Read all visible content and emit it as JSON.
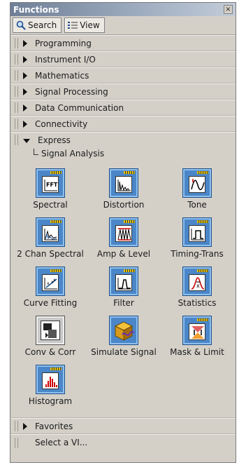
{
  "window": {
    "title": "Functions",
    "close_glyph": "×"
  },
  "toolbar": {
    "search_label": "Search",
    "view_label": "View"
  },
  "categories": [
    "Programming",
    "Instrument I/O",
    "Mathematics",
    "Signal Processing",
    "Data Communication",
    "Connectivity"
  ],
  "express": {
    "label": "Express",
    "subcategory": "Signal Analysis",
    "vis": [
      "Spectral",
      "Distortion",
      "Tone",
      "2 Chan Spectral",
      "Amp & Level",
      "Timing-Trans",
      "Curve Fitting",
      "Filter",
      "Statistics",
      "Conv & Corr",
      "Simulate Signal",
      "Mask & Limit",
      "Histogram"
    ]
  },
  "bottom": {
    "favorites": "Favorites",
    "select_vi": "Select a VI..."
  },
  "colors": {
    "icon_blue": "#4a86c8",
    "titlebar": "#6f7f97",
    "panel": "#d4d0c8"
  }
}
